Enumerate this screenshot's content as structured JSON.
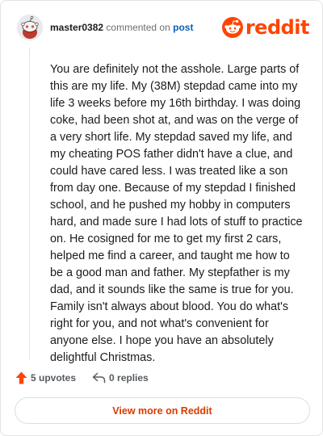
{
  "comment": {
    "username": "master0382",
    "action_text": "commented on",
    "post_link": "post",
    "body": "You are definitely not the asshole. Large parts of this are my life. My (38M) stepdad came into my life 3 weeks before my 16th birthday. I was doing coke, had been shot at, and was on the verge of a very short life. My stepdad saved my life, and my cheating POS father didn't have a clue, and could have cared less. I was treated like a son from day one. Because of my stepdad I finished school, and he pushed my hobby in computers hard, and made sure I had lots of stuff to practice on. He cosigned for me to get my first 2 cars, helped me find a career, and taught me how to be a good man and father. My stepfather is my dad, and it sounds like the same is true for you. Family isn't always about blood. You do what's right for you, and not what's convenient for anyone else. I hope you have an absolutely delightful Christmas.",
    "upvotes": "5 upvotes",
    "replies": "0 replies"
  },
  "brand": {
    "logo_text": "reddit",
    "color": "#ff4500"
  },
  "view_more_label": "View more on Reddit",
  "icons": {
    "avatar": "snoo-avatar-icon",
    "logo": "reddit-snoo-icon",
    "upvote": "upvote-arrow-icon",
    "reply": "reply-arrow-icon"
  }
}
